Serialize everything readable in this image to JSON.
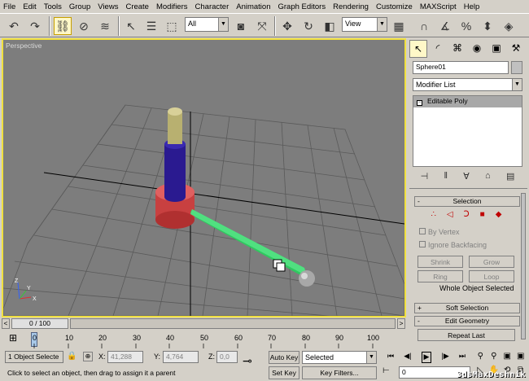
{
  "menu": [
    "File",
    "Edit",
    "Tools",
    "Group",
    "Views",
    "Create",
    "Modifiers",
    "Character",
    "Animation",
    "Graph Editors",
    "Rendering",
    "Customize",
    "MAXScript",
    "Help"
  ],
  "toolbar": {
    "selection_filter": "All",
    "reference_coord": "View"
  },
  "viewport": {
    "label": "Perspective",
    "axis_x": "X",
    "axis_y": "Y",
    "axis_z": "Z"
  },
  "command_panel": {
    "object_name": "Sphere01",
    "modifier_list": "Modifier List",
    "stack_item": "Editable Poly",
    "selection_rollout": "Selection",
    "by_vertex": "By Vertex",
    "ignore_backfacing": "Ignore Backfacing",
    "shrink": "Shrink",
    "grow": "Grow",
    "ring": "Ring",
    "loop": "Loop",
    "selection_status": "Whole Object Selected",
    "soft_selection": "Soft Selection",
    "edit_geometry": "Edit Geometry",
    "repeat_last": "Repeat Last",
    "plus": "+",
    "minus": "-"
  },
  "timeline": {
    "frame_display": "0 / 100",
    "prev": "<",
    "next": ">",
    "ticks": [
      "0",
      "10",
      "20",
      "30",
      "40",
      "50",
      "60",
      "70",
      "80",
      "90",
      "100"
    ]
  },
  "status": {
    "selection": "1 Object Selecte",
    "x_label": "X:",
    "x_value": "41,288",
    "y_label": "Y:",
    "y_value": "4,764",
    "z_label": "Z:",
    "z_value": "0,0",
    "auto_key": "Auto Key",
    "key_mode": "Selected",
    "set_key": "Set Key",
    "key_filters": "Key Filters...",
    "prompt": "Click to select an object, then drag to assign it a parent",
    "frame": "0"
  },
  "colors": {
    "viewport_bg": "#7d7d7d",
    "viewport_border": "#f0e040",
    "cylinder_top": "#c8c080",
    "cylinder_mid": "#2a1a90",
    "base": "#d84848",
    "arm": "#30c860",
    "sphere": "#a0a0a0"
  },
  "watermark": "3dsMaxDeshnik"
}
